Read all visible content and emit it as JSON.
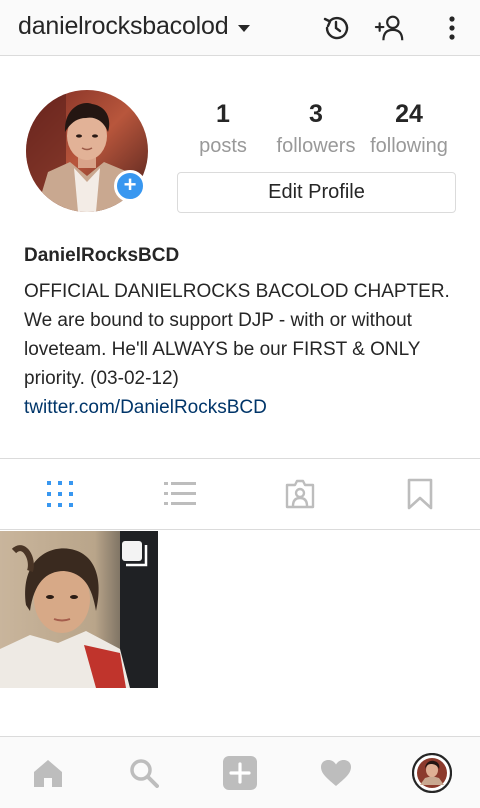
{
  "header": {
    "username": "danielrocksbacolod",
    "icons": [
      "chevron-down-icon",
      "history-icon",
      "add-person-icon",
      "more-vertical-icon"
    ]
  },
  "profile": {
    "stats": [
      {
        "value": "1",
        "label": "posts"
      },
      {
        "value": "3",
        "label": "followers"
      },
      {
        "value": "24",
        "label": "following"
      }
    ],
    "edit_button": "Edit Profile",
    "full_name": "DanielRocksBCD",
    "bio": "OFFICIAL DANIELROCKS BACOLOD CHAPTER. We are bound to support DJP - with or without loveteam. He'll ALWAYS be our FIRST & ONLY priority. (03-02-12)",
    "link": "twitter.com/DanielRocksBCD"
  },
  "tabs": [
    "grid-view-icon",
    "list-view-icon",
    "tagged-icon",
    "saved-icon"
  ],
  "colors": {
    "accent": "#3897f0",
    "link": "#003569",
    "border": "#dbdbdb",
    "muted": "#999999",
    "inactive_icon": "#bdbdbd"
  },
  "bottom_nav": [
    "home-icon",
    "search-icon",
    "new-post-icon",
    "activity-icon",
    "profile-icon"
  ]
}
